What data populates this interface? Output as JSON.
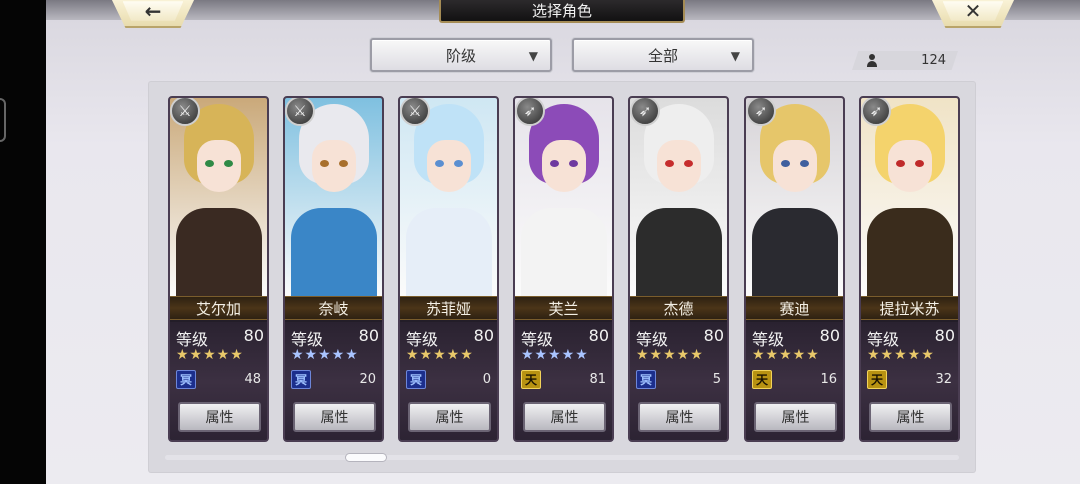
{
  "header": {
    "title": "选择角色",
    "back_icon": "←",
    "close_icon": "✕"
  },
  "filters": [
    {
      "label": "阶级",
      "arrow": "▼"
    },
    {
      "label": "全部",
      "arrow": "▼"
    }
  ],
  "character_count": "124",
  "characters": [
    {
      "name": "艾尔加",
      "level_label": "等级",
      "level": "80",
      "stars": "★★★★★",
      "star_color": "#e8c86a",
      "rank": "冥",
      "rank_color": "blue",
      "count": "48",
      "attr_label": "属性",
      "type_icon": "⚔",
      "hair": "#d7b458",
      "eye": "#2f8a46",
      "body": "#3a2a22",
      "bg": "#caa97a"
    },
    {
      "name": "奈岐",
      "level_label": "等级",
      "level": "80",
      "stars": "★★★★★",
      "star_color": "#a9c4ff",
      "rank": "冥",
      "rank_color": "blue",
      "count": "20",
      "attr_label": "属性",
      "type_icon": "⚔",
      "hair": "#e9e9ee",
      "eye": "#a86f2c",
      "body": "#3a86c7",
      "bg": "#7fc0e0"
    },
    {
      "name": "苏菲娅",
      "level_label": "等级",
      "level": "80",
      "stars": "★★★★★",
      "star_color": "#e8c86a",
      "rank": "冥",
      "rank_color": "blue",
      "count": "0",
      "attr_label": "属性",
      "type_icon": "⚔",
      "hair": "#bfe2f7",
      "eye": "#5b8fd1",
      "body": "#e6eef8",
      "bg": "#cfe7f3"
    },
    {
      "name": "芙兰",
      "level_label": "等级",
      "level": "80",
      "stars": "★★★★★",
      "star_color": "#a9c4ff",
      "rank": "天",
      "rank_color": "gold",
      "count": "81",
      "attr_label": "属性",
      "type_icon": "➶",
      "hair": "#8c4bb8",
      "eye": "#6f3aa0",
      "body": "#f3f3f3",
      "bg": "#e6e3ea"
    },
    {
      "name": "杰德",
      "level_label": "等级",
      "level": "80",
      "stars": "★★★★★",
      "star_color": "#e8c86a",
      "rank": "冥",
      "rank_color": "blue",
      "count": "5",
      "attr_label": "属性",
      "type_icon": "➶",
      "hair": "#eeeeee",
      "eye": "#c62d2d",
      "body": "#2c2c2c",
      "bg": "#dcdcdc"
    },
    {
      "name": "赛迪",
      "level_label": "等级",
      "level": "80",
      "stars": "★★★★★",
      "star_color": "#e8c86a",
      "rank": "天",
      "rank_color": "gold",
      "count": "16",
      "attr_label": "属性",
      "type_icon": "➶",
      "hair": "#e6c66a",
      "eye": "#3f5f9e",
      "body": "#2a2a30",
      "bg": "#d7d4d8"
    },
    {
      "name": "提拉米苏",
      "level_label": "等级",
      "level": "80",
      "stars": "★★★★★",
      "star_color": "#e8c86a",
      "rank": "天",
      "rank_color": "gold",
      "count": "32",
      "attr_label": "属性",
      "type_icon": "➶",
      "hair": "#f4d36c",
      "eye": "#c02a2a",
      "body": "#3a2c1c",
      "bg": "#f0e3c6"
    }
  ]
}
